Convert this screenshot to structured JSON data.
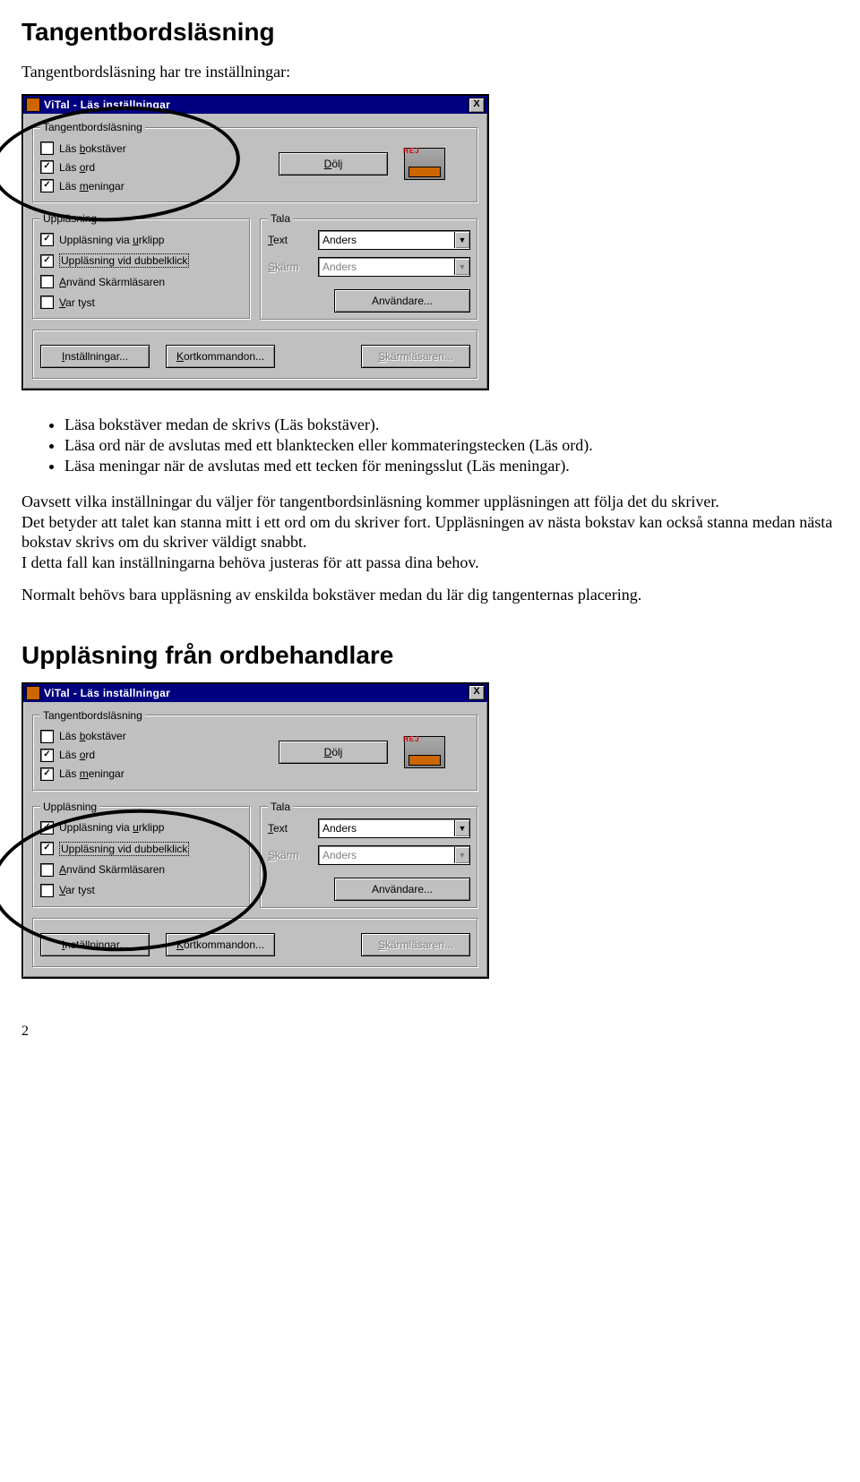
{
  "doc": {
    "h1": "Tangentbordsläsning",
    "intro": "Tangentbordsläsning har tre inställningar:",
    "bullets": [
      "Läsa bokstäver medan de skrivs (Läs bokstäver).",
      "Läsa ord när de avslutas med ett blanktecken eller kommateringstecken (Läs ord).",
      "Läsa meningar när de avslutas med ett tecken för meningsslut (Läs meningar)."
    ],
    "p1": "Oavsett vilka inställningar du väljer för tangentbordsinläsning kommer uppläsningen att följa det du skriver.",
    "p2": "Det betyder att talet kan stanna mitt i ett ord om du skriver fort. Uppläsningen av nästa bokstav kan också stanna medan nästa bokstav skrivs om du skriver väldigt snabbt.",
    "p3": "I detta fall kan inställningarna behöva justeras för att passa dina behov.",
    "p4": "Normalt behövs bara uppläsning av enskilda bokstäver medan du lär dig tangenternas placering.",
    "h2": "Uppläsning från ordbehandlare",
    "pageNum": "2"
  },
  "dialog": {
    "title": "ViTal - Läs inställningar",
    "groups": {
      "tangent": {
        "legend": "Tangentbordsläsning",
        "chk_bokstaver": {
          "pre": "Läs ",
          "u": "b",
          "post": "okstäver",
          "checked": false
        },
        "chk_ord": {
          "pre": "Läs ",
          "u": "o",
          "post": "rd",
          "checked": true
        },
        "chk_meningar": {
          "pre": "Läs ",
          "u": "m",
          "post": "eningar",
          "checked": true
        },
        "dolj": {
          "u": "D",
          "post": "ölj"
        }
      },
      "upplasning": {
        "legend": "Uppläsning",
        "chk_urklipp": {
          "pre": "Uppläsning via ",
          "u": "u",
          "post": "rklipp",
          "checked": true
        },
        "chk_dubbel_pre": "Uppläsning vid dubbelklick",
        "chk_dubbel": {
          "checked": true
        },
        "chk_skarml": {
          "pre": "",
          "u": "A",
          "post": "nvänd Skärmläsaren",
          "checked": false
        },
        "chk_tyst": {
          "pre": "",
          "u": "V",
          "post": "ar tyst",
          "checked": false
        }
      },
      "tala": {
        "legend": "Tala",
        "text_lbl_u": "T",
        "text_lbl_post": "ext",
        "skarm_lbl_u": "S",
        "skarm_lbl_post": "kärm",
        "text_val": "Anders",
        "skarm_val": "Anders",
        "anvandare_btn": "Användare..."
      }
    },
    "bottom": {
      "installningar_u": "I",
      "installningar_post": "nställningar...",
      "kortkommandon_u": "K",
      "kortkommandon_post": "ortkommandon...",
      "skarmlasaren_u": "S",
      "skarmlasaren_post": "kärmläsaren..."
    },
    "close_x": "X"
  }
}
